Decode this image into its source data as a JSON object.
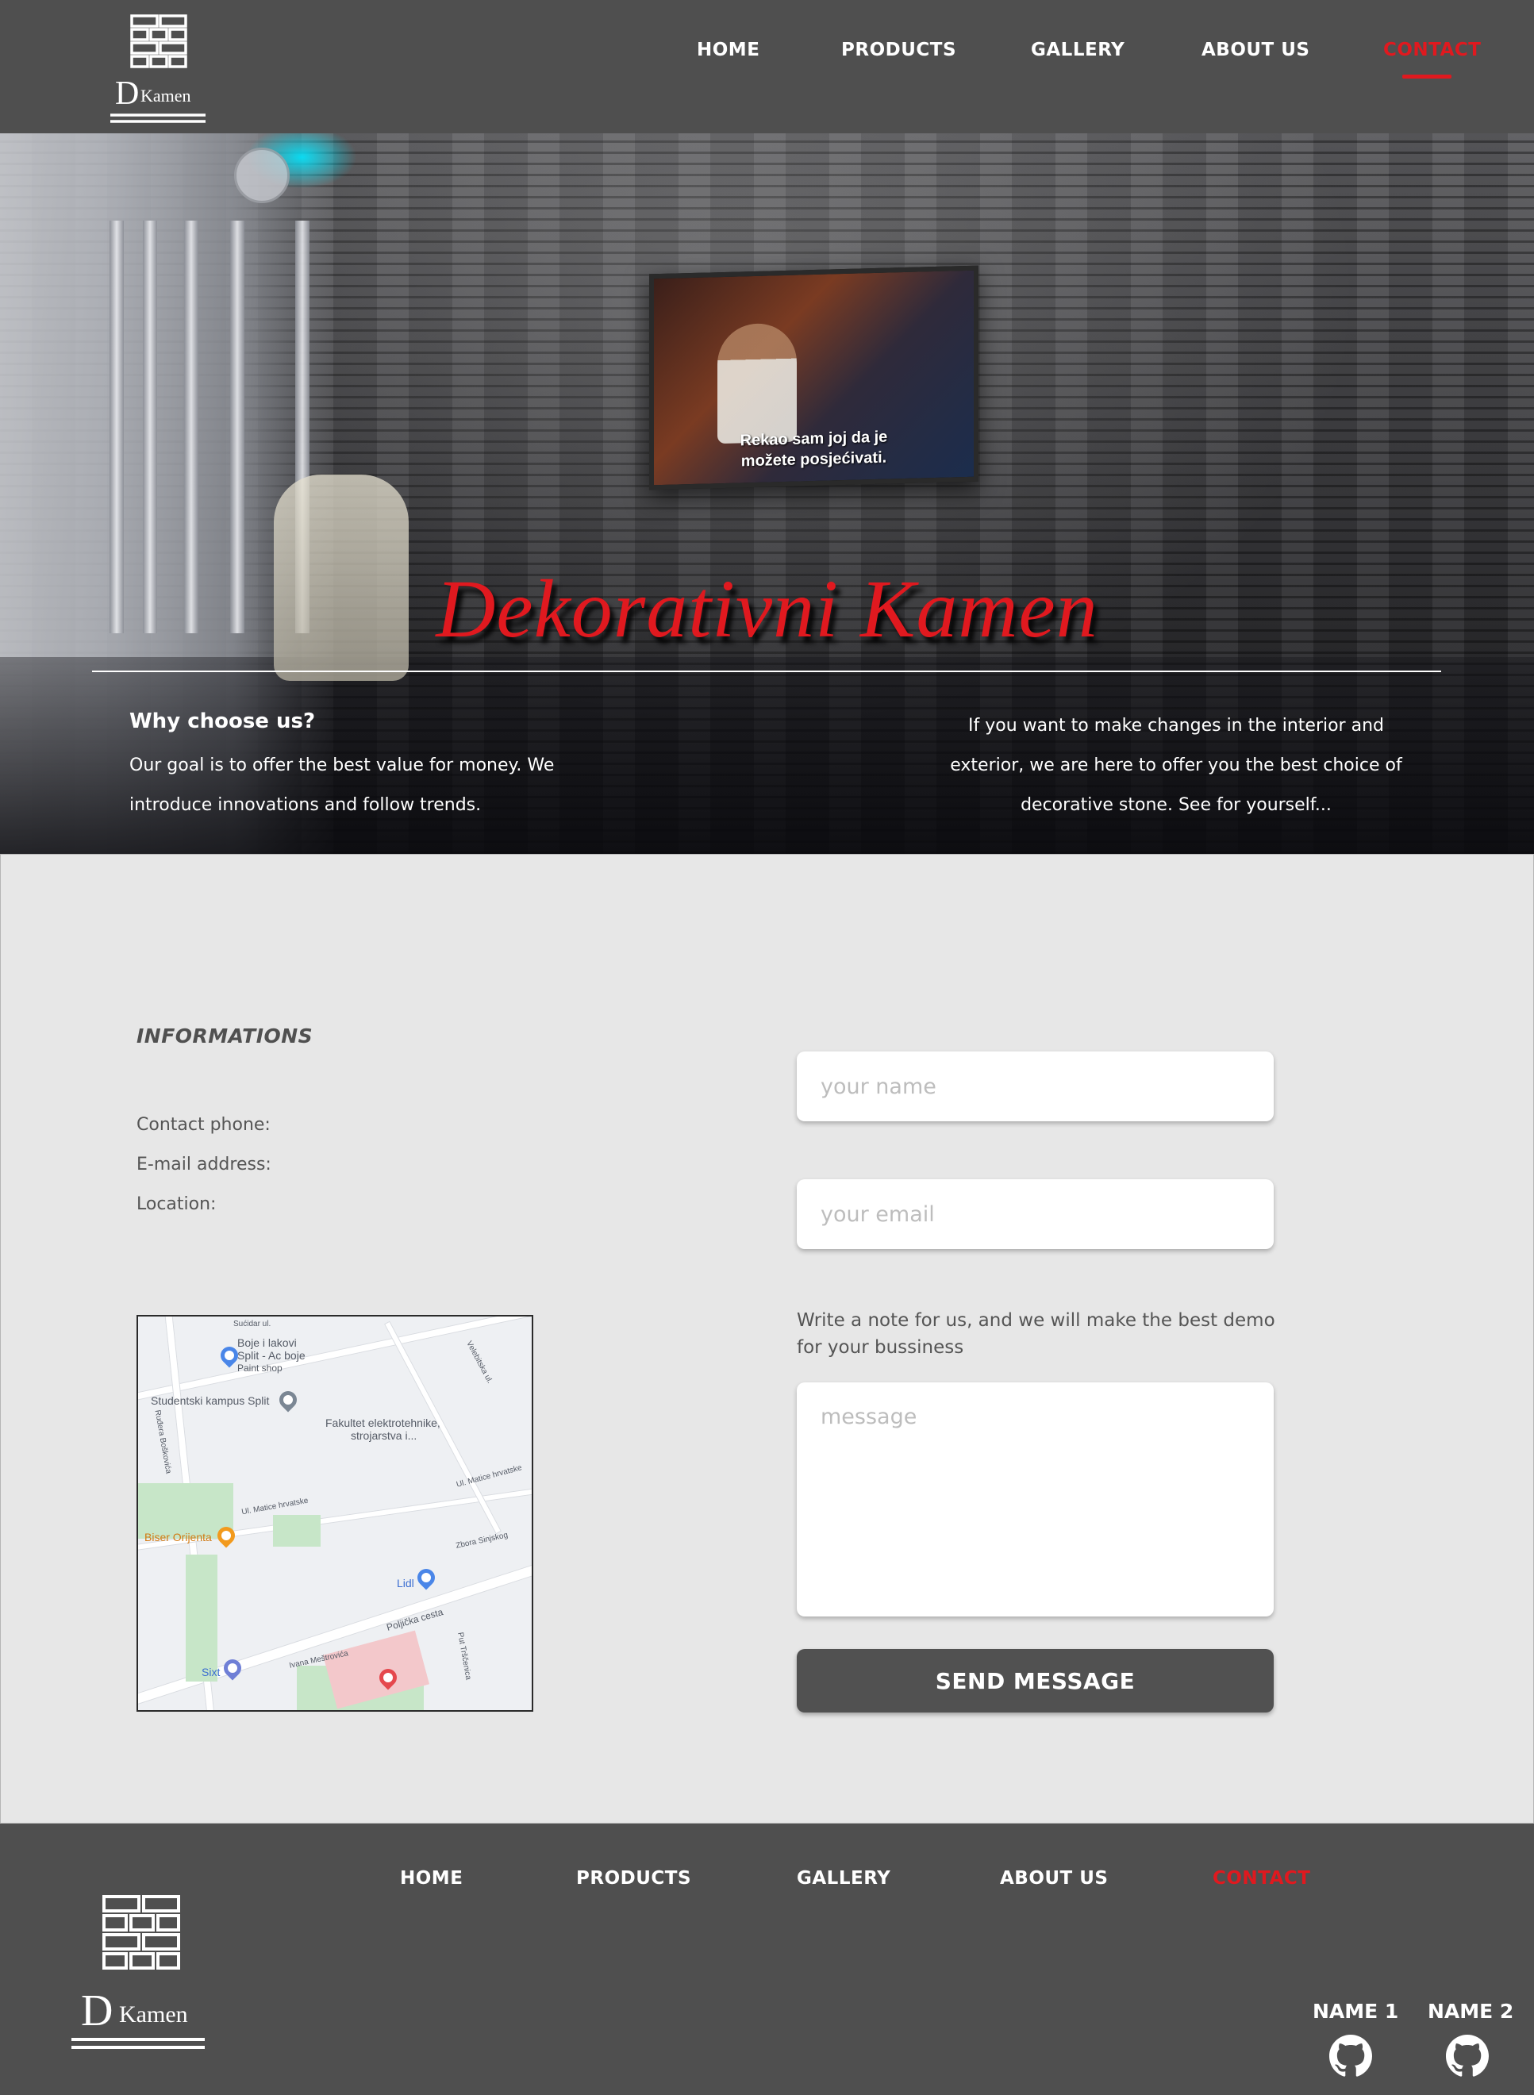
{
  "brand": {
    "initial": "D",
    "name": "Kamen"
  },
  "nav": {
    "items": [
      {
        "label": "HOME"
      },
      {
        "label": "PRODUCTS"
      },
      {
        "label": "GALLERY"
      },
      {
        "label": "ABOUT US"
      },
      {
        "label": "CONTACT"
      }
    ],
    "active": "CONTACT"
  },
  "hero": {
    "tv_caption_line1": "Rekao sam joj da je",
    "tv_caption_line2": "možete posjećivati.",
    "title": "Dekorativni Kamen",
    "why_title": "Why choose us?",
    "why_text": "Our goal is to offer the best value for money. We introduce innovations and follow trends.",
    "right_text": "If you want to make changes in the interior and exterior, we are here to offer you the best choice of decorative stone. See for yourself..."
  },
  "contact": {
    "info_title": "INFORMATIONS",
    "phone_label": "Contact phone:",
    "email_label": "E-mail address:",
    "location_label": "Location:",
    "name_placeholder": "your name",
    "email_placeholder": "your email",
    "note": "Write a note for us, and we will make the best demo for your bussiness",
    "message_placeholder": "message",
    "send_label": "SEND MESSAGE"
  },
  "map": {
    "labels": {
      "paint1": "Boje i lakovi",
      "paint2": "Split - Ac boje",
      "paint3": "Paint shop",
      "campus": "Studentski kampus Split",
      "faculty1": "Fakultet elektrotehnike,",
      "faculty2": "strojarstva i...",
      "restaurant": "Biser Orijenta",
      "lidl": "Lidl",
      "sixt": "Sixt",
      "road1": "Poljička cesta",
      "road2": "Ul. Matice hrvatske",
      "road3": "Velebitska ul.",
      "road4": "Ul. Matice hrvatske",
      "road5": "Ruđera Boškovića",
      "road6": "Sućidar ul.",
      "road7": "Put Trščenica",
      "road8": "Ivana Meštrovića",
      "road9": "Zbora Sinjskog"
    },
    "colors": {
      "green": "#c7e6c8",
      "pink": "#f3c8cb",
      "road": "#ffffff"
    }
  },
  "footer": {
    "name1": "NAME 1",
    "name2": "NAME 2"
  },
  "colors": {
    "accent": "#e0191f",
    "dark": "#4f4f4f",
    "light_bg": "#e7e7e7"
  }
}
